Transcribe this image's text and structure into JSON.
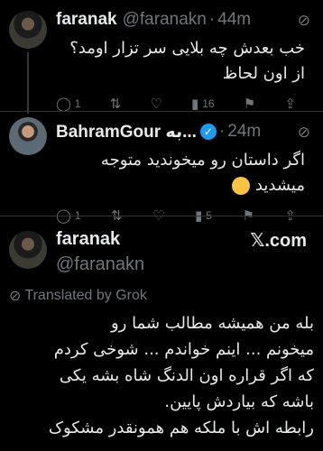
{
  "tweets": [
    {
      "name": "faranak",
      "handle": "@faranakn",
      "time": "44m",
      "text": "خب بعدش چه بلایی سر تزار اومد؟ از اون لحاظ",
      "replies": "1",
      "retweets": "",
      "likes": "",
      "views": "16"
    },
    {
      "name": "BahramGour به...",
      "time": "24m",
      "text": "اگر داستان رو میخوندید متوجه میشدید",
      "replies": "1",
      "retweets": "",
      "likes": "",
      "views": "5"
    }
  ],
  "quoted": {
    "name": "faranak",
    "handle": "@faranakn",
    "source": "𝕏.com",
    "translated_label": "Translated by Grok",
    "text_lines": [
      "بله من همیشه مطالب شما رو",
      "میخونم ... اینم خواندم ... شوخی کردم",
      "که اگر قراره اون الدنگ شاه بشه یکی",
      "باشه که بیاردش پایین.",
      "رابطه اش با ملکه هم همونقدر مشکوک"
    ]
  },
  "icons": [
    "grok-icon",
    "reply-icon",
    "retweet-icon",
    "like-icon",
    "views-icon",
    "bookmark-icon",
    "share-icon",
    "verified-icon"
  ]
}
